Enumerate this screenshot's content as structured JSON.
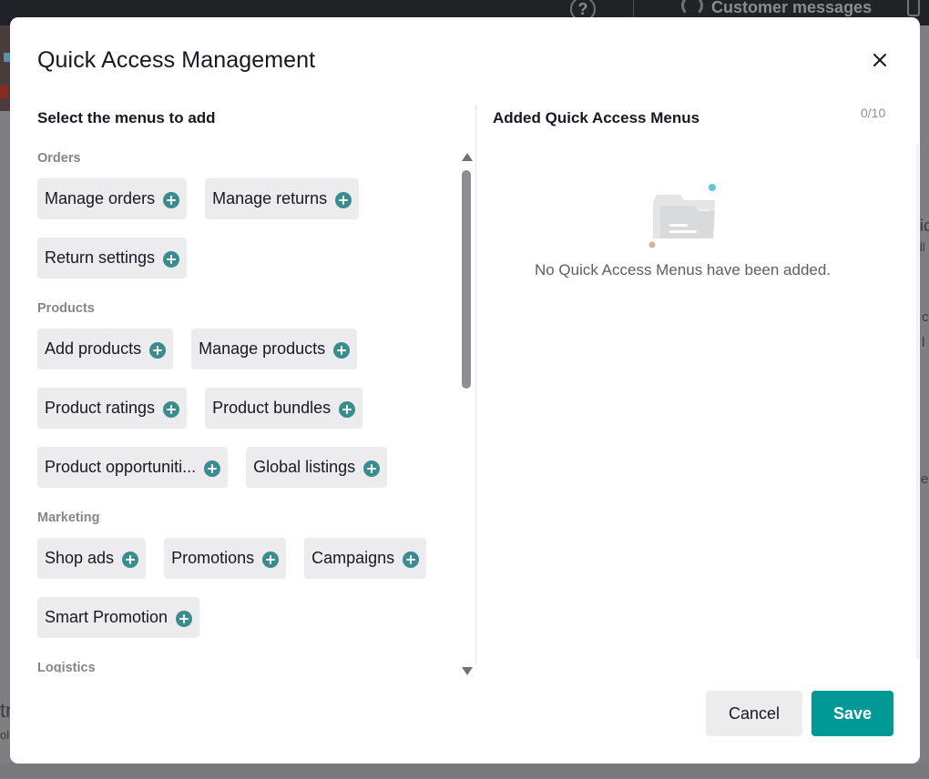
{
  "background": {
    "topbar": {
      "customer_messages_label": "Customer messages"
    },
    "fragments": [
      "ic",
      "ll",
      "c",
      "l",
      "e",
      "tr",
      "ol"
    ]
  },
  "modal": {
    "title": "Quick Access Management",
    "close_icon": "close-icon",
    "left": {
      "heading": "Select the menus to add",
      "categories": [
        {
          "name": "Orders",
          "items": [
            "Manage orders",
            "Manage returns",
            "Return settings"
          ]
        },
        {
          "name": "Products",
          "items": [
            "Add products",
            "Manage products",
            "Product ratings",
            "Product bundles",
            "Product opportuniti...",
            "Global listings"
          ]
        },
        {
          "name": "Marketing",
          "items": [
            "Shop ads",
            "Promotions",
            "Campaigns",
            "Smart Promotion"
          ]
        },
        {
          "name": "Logistics",
          "items": []
        }
      ]
    },
    "right": {
      "heading": "Added Quick Access Menus",
      "counter": "0/10",
      "empty_text": "No Quick Access Menus have been added."
    },
    "buttons": {
      "cancel": "Cancel",
      "save": "Save"
    }
  },
  "colors": {
    "accent": "#009995",
    "plus_icon": "#3b8c8f",
    "chip_bg": "#ececee"
  }
}
